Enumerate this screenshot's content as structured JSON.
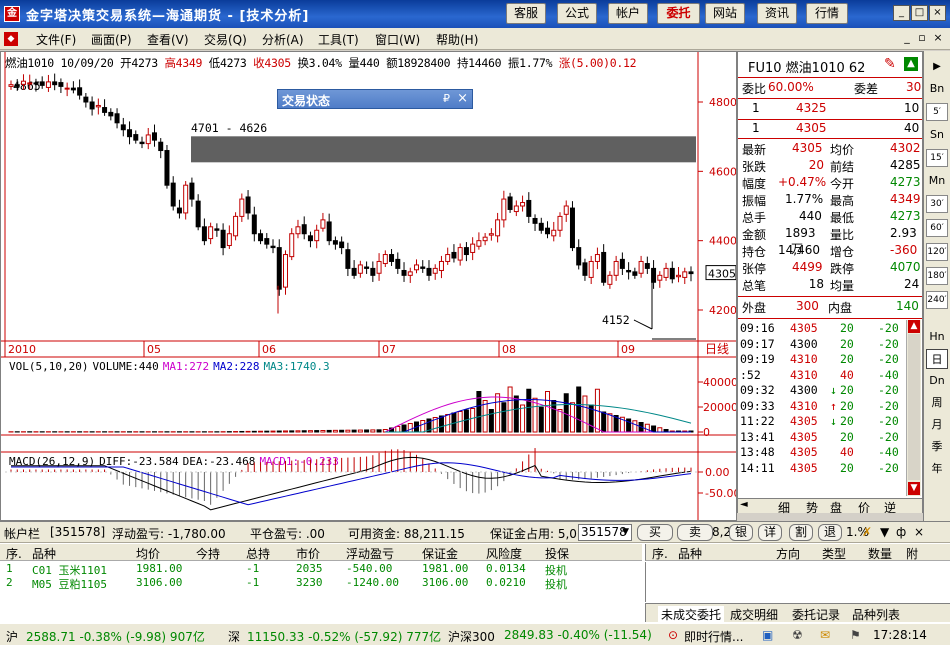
{
  "app": {
    "title": "金字塔决策交易系统—海通期货  -  [技术分析]",
    "buttons": [
      "客服",
      "公式",
      "帐户",
      "委托",
      "网站",
      "资讯",
      "行情"
    ],
    "active_button": "委托"
  },
  "menu": [
    "文件(F)",
    "画面(P)",
    "查看(V)",
    "交易(Q)",
    "分析(A)",
    "工具(T)",
    "窗口(W)",
    "帮助(H)"
  ],
  "infoline": {
    "symbol_date": "燃油1010 10/09/20",
    "open": "开4273",
    "high": "高4349",
    "low": "低4273",
    "close": "收4305",
    "turnover": "换3.04%",
    "volume": "量440",
    "amount": "额18928400",
    "position": "持14460",
    "amplitude": "振1.77%",
    "change": "涨(5.00)0.12"
  },
  "chart": {
    "y_ticks": [
      "4800",
      "4600",
      "4400",
      "4200"
    ],
    "current_price_label": "4305",
    "x_ticks": [
      "2010",
      "05",
      "06",
      "07",
      "08",
      "09"
    ],
    "period_label": "日线",
    "annot_range": "4701 - 4626",
    "annot_high": "4865",
    "annot_low": "4152",
    "vol_legend": {
      "label": "VOL(5,10,20)",
      "volume": "VOLUME:440",
      "ma1": "MA1:272",
      "ma2": "MA2:228",
      "ma3": "MA3:1740.3"
    },
    "vol_ticks": [
      "40000",
      "20000",
      "0"
    ],
    "macd_legend": {
      "label": "MACD(26,12,9)",
      "diff": "DIFF:-23.584",
      "dea": "DEA:-23.468",
      "macd": "MACD1:-0.233"
    },
    "macd_ticks": [
      "0.00",
      "-50.00"
    ],
    "colors": {
      "up": "#c00000",
      "down": "#000000",
      "band": "#606060",
      "ma1": "#cc00cc",
      "ma2": "#0000cc",
      "ma3": "#008888"
    }
  },
  "trade_status": {
    "title": "交易状态",
    "pin": "₽",
    "close": "×"
  },
  "quote": {
    "symbol": "FU10 燃油1010 62",
    "wei_bi_label": "委比",
    "wei_bi": "60.00%",
    "wei_cha_label": "委差",
    "wei_cha": "30",
    "ask": {
      "idx": "1",
      "price": "4325",
      "vol": "10"
    },
    "bid": {
      "idx": "1",
      "price": "4305",
      "vol": "40"
    },
    "rows": [
      [
        "最新",
        "4305",
        "均价",
        "4302"
      ],
      [
        "张跌",
        "20",
        "前结",
        "4285"
      ],
      [
        "幅度",
        "+0.47%",
        "今开",
        "4273"
      ],
      [
        "振幅",
        "1.77%",
        "最高",
        "4349"
      ],
      [
        "总手",
        "440",
        "最低",
        "4273"
      ],
      [
        "金额",
        "1893万",
        "量比",
        "2.93"
      ],
      [
        "持仓",
        "14,460",
        "增仓",
        "-360"
      ],
      [
        "张停",
        "4499",
        "跌停",
        "4070"
      ],
      [
        "总笔",
        "18",
        "均量",
        "24"
      ]
    ],
    "outer_label": "外盘",
    "outer": "300",
    "inner_label": "内盘",
    "inner": "140",
    "ticks": [
      [
        "09:16",
        "4305",
        "",
        "20",
        "-20"
      ],
      [
        "09:17",
        "4300",
        "",
        "20",
        "-20"
      ],
      [
        "09:19",
        "4310",
        "",
        "20",
        "-20"
      ],
      [
        ":52",
        "4310",
        "",
        "40",
        "-40"
      ],
      [
        "09:32",
        "4300",
        "↓",
        "20",
        "-20"
      ],
      [
        "09:33",
        "4310",
        "↑",
        "20",
        "-20"
      ],
      [
        "11:22",
        "4305",
        "↓",
        "20",
        "-20"
      ],
      [
        "13:41",
        "4305",
        "",
        "20",
        "-20"
      ],
      [
        "13:48",
        "4305",
        "",
        "40",
        "-40"
      ],
      [
        "14:11",
        "4305",
        "",
        "20",
        "-20"
      ]
    ],
    "tabs": [
      "细",
      "势",
      "盘",
      "价",
      "逆"
    ]
  },
  "sidebar": [
    "Bn",
    "Sn",
    "Mn",
    "Hn",
    "日",
    "Dn",
    "周",
    "月",
    "季",
    "年"
  ],
  "account": {
    "label": "帐户栏",
    "id": "[351578]",
    "float_pl": "浮动盈亏: -1,780.00",
    "close_pl": "平仓盈亏: .00",
    "available": "可用资金: 88,211.15",
    "margin": "保证金占用: 5,0",
    "select": "351578",
    "buttons": [
      "买",
      "卖",
      "银",
      "详",
      "割",
      "退"
    ],
    "tail": "1.%"
  },
  "positions": {
    "headers": [
      "序.",
      "品种",
      "均价",
      "今持",
      "总持",
      "市价",
      "浮动盈亏",
      "保证金",
      "风险度",
      "投保"
    ],
    "rows": [
      [
        "1",
        "C01 玉米1101",
        "1981.00",
        "",
        "-1",
        "2035",
        "-540.00",
        "1981.00",
        "0.0134",
        "投机"
      ],
      [
        "2",
        "M05 豆粕1105",
        "3106.00",
        "",
        "-1",
        "3230",
        "-1240.00",
        "3106.00",
        "0.0210",
        "投机"
      ]
    ]
  },
  "orders": {
    "headers": [
      "序.",
      "品种",
      "方向",
      "类型",
      "数量",
      "附"
    ],
    "tabs": [
      "未成交委托",
      "成交明细",
      "委托记录",
      "品种列表"
    ]
  },
  "status": {
    "sh": "沪",
    "sh_val": "2588.71 -0.38% (-9.98) 907亿",
    "sz": "深",
    "sz_val": "11150.33 -0.52% (-57.92) 777亿",
    "hs": "沪深300",
    "hs_val": "2849.83 -0.40% (-11.54)",
    "news": "即时行情...",
    "time": "17:28:14"
  }
}
